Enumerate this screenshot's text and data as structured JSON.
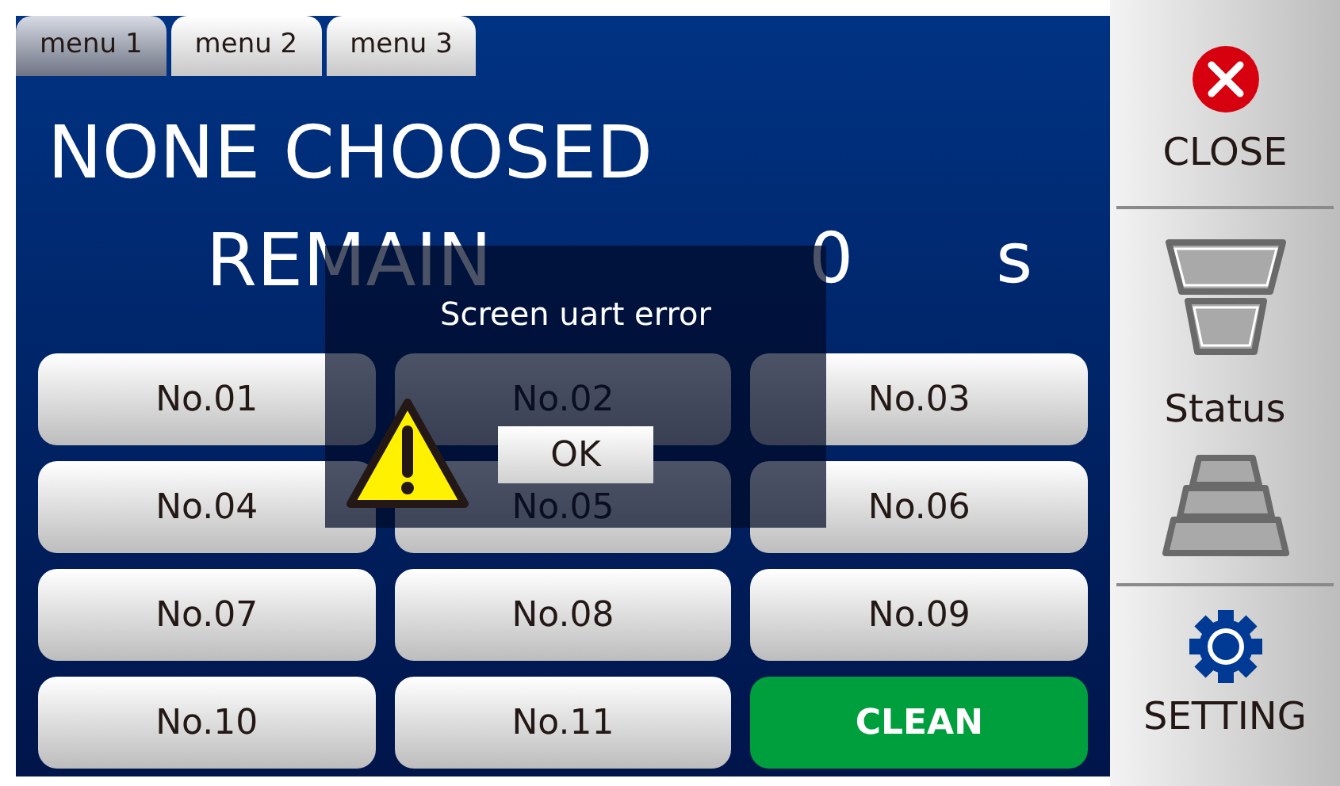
{
  "tabs": [
    {
      "label": "menu 1",
      "selected": true
    },
    {
      "label": "menu 2",
      "selected": false
    },
    {
      "label": "menu 3",
      "selected": false
    }
  ],
  "title": "NONE CHOOSED",
  "remain": {
    "label": "REMAIN",
    "value": "0",
    "unit": "s"
  },
  "buttons": [
    {
      "label": "No.01",
      "kind": "slot"
    },
    {
      "label": "No.02",
      "kind": "slot"
    },
    {
      "label": "No.03",
      "kind": "slot"
    },
    {
      "label": "No.04",
      "kind": "slot"
    },
    {
      "label": "No.05",
      "kind": "slot"
    },
    {
      "label": "No.06",
      "kind": "slot"
    },
    {
      "label": "No.07",
      "kind": "slot"
    },
    {
      "label": "No.08",
      "kind": "slot"
    },
    {
      "label": "No.09",
      "kind": "slot"
    },
    {
      "label": "No.10",
      "kind": "slot"
    },
    {
      "label": "No.11",
      "kind": "slot"
    },
    {
      "label": "CLEAN",
      "kind": "action"
    }
  ],
  "sidebar": {
    "close": "CLOSE",
    "status": "Status",
    "setting": "SETTING"
  },
  "dialog": {
    "message": "Screen uart error",
    "button": "OK"
  }
}
